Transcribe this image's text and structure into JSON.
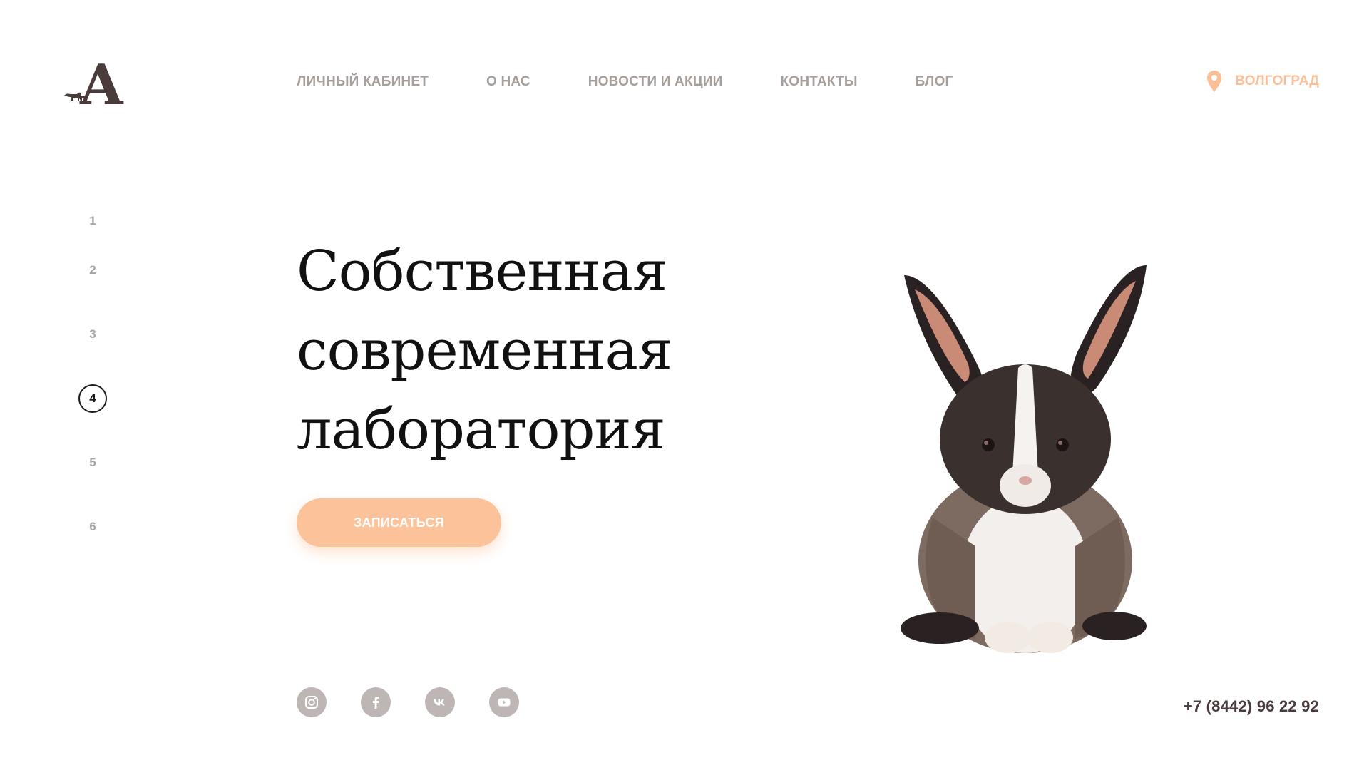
{
  "logo": {
    "letter": "A",
    "icon": "cat-dog-logo-icon"
  },
  "nav": {
    "items": [
      "ЛИЧНЫЙ КАБИНЕТ",
      "О НАС",
      "НОВОСТИ И АКЦИИ",
      "КОНТАКТЫ",
      "БЛОГ"
    ]
  },
  "city": {
    "label": "ВОЛГОГРАД",
    "icon": "location-pin-icon",
    "color": "#fbbf97"
  },
  "pager": {
    "pages": [
      "1",
      "2",
      "3",
      "4",
      "5",
      "6"
    ],
    "active": "4"
  },
  "hero": {
    "title_lines": [
      "Собственная",
      "современная",
      "лаборатория"
    ],
    "cta_label": "ЗАПИСАТЬСЯ",
    "cta_color": "#fcc29a"
  },
  "social": [
    "instagram-icon",
    "facebook-icon",
    "vk-icon",
    "youtube-icon"
  ],
  "contact": {
    "phone": "+7 (8442) 96 22 92"
  }
}
